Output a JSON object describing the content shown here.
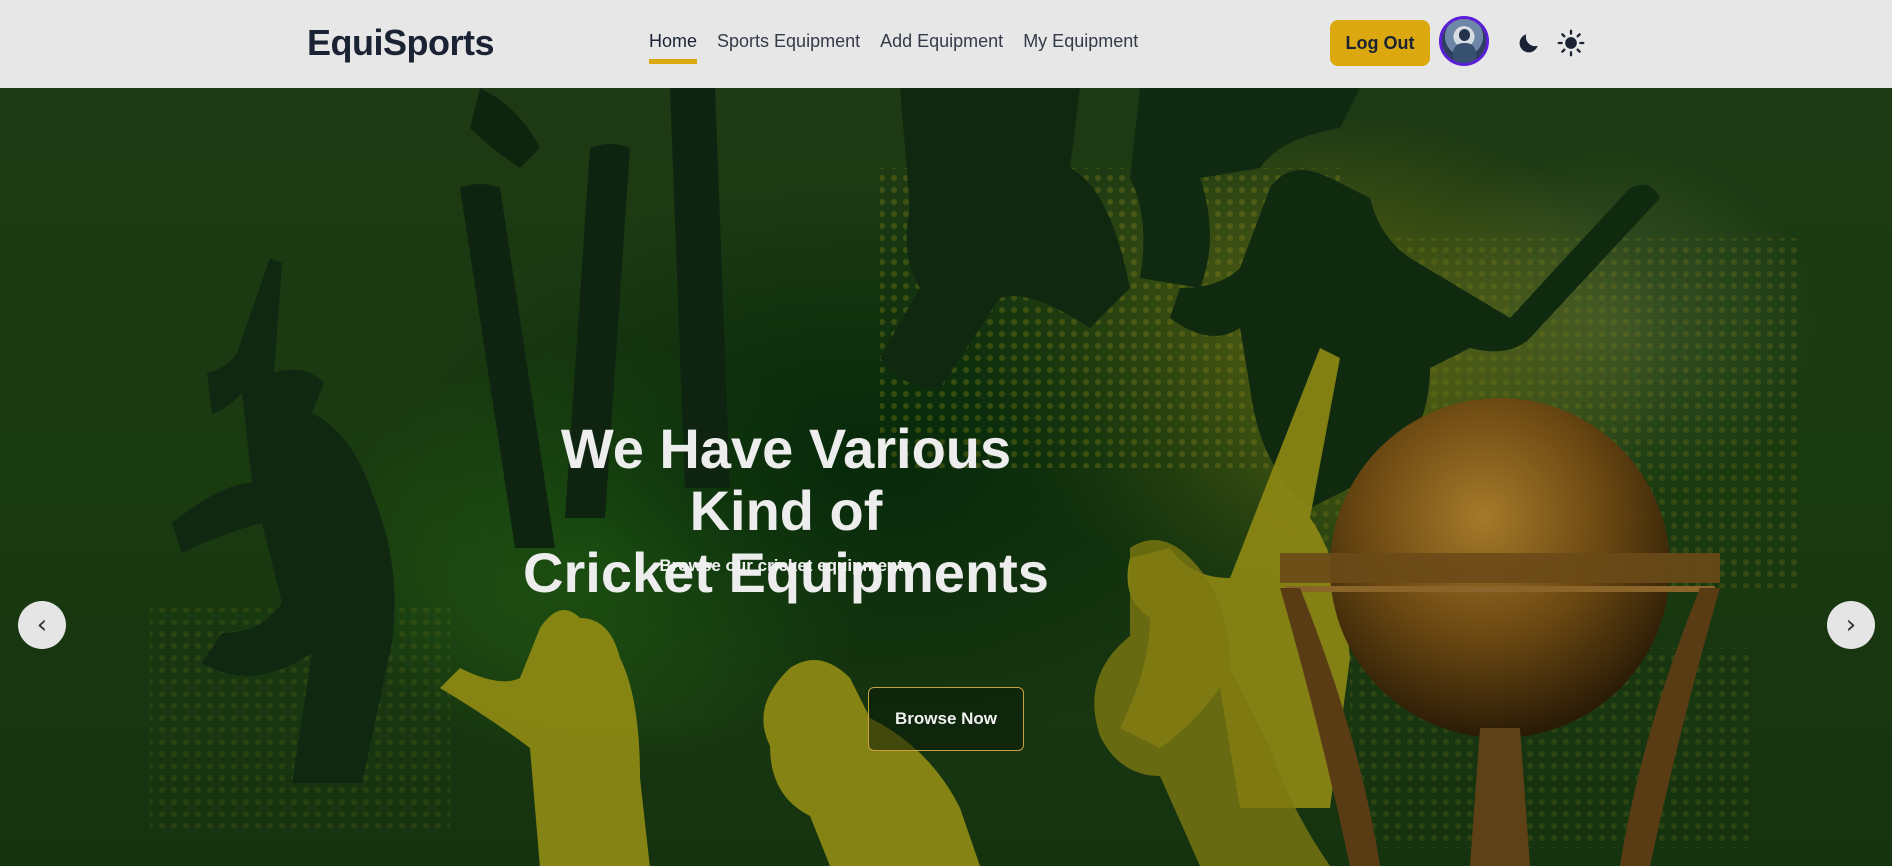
{
  "navbar": {
    "brand": "EquiSports",
    "links": [
      {
        "label": "Home",
        "active": true
      },
      {
        "label": "Sports Equipment",
        "active": false
      },
      {
        "label": "Add Equipment",
        "active": false
      },
      {
        "label": "My Equipment",
        "active": false
      }
    ],
    "logout_label": "Log Out",
    "avatar_icon": "user-avatar",
    "theme_icons": [
      "moon-icon",
      "sun-icon"
    ],
    "accent_color": "#dba90f",
    "avatar_border_color": "#5b1fd8"
  },
  "hero": {
    "title_line1": "We Have Various Kind of",
    "title_line2": "Cricket Equipments",
    "subtitle": "Browse our cricket equipments",
    "cta_label": "Browse Now",
    "prev_label": "‹",
    "next_label": "›"
  }
}
